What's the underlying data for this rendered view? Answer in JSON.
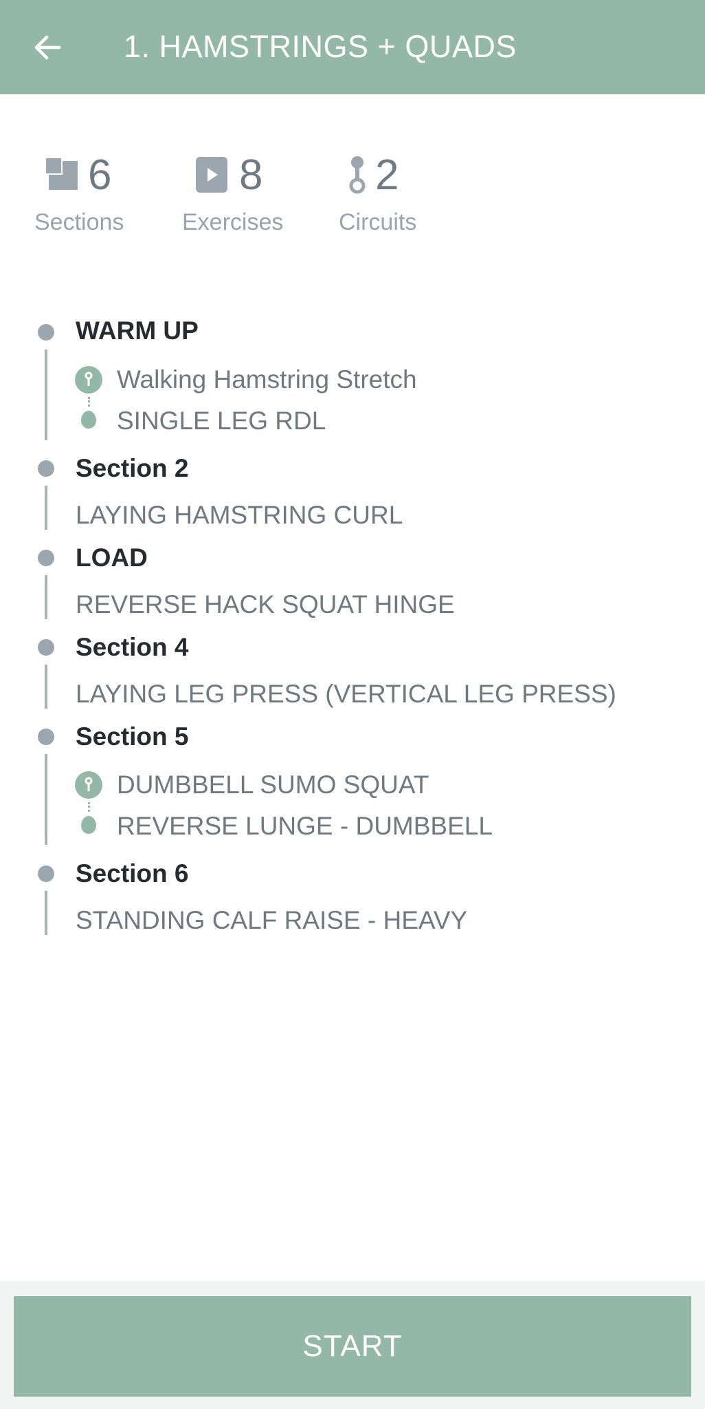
{
  "header": {
    "title": "1. HAMSTRINGS + QUADS",
    "back_icon": "arrow-left-icon"
  },
  "stats": [
    {
      "icon": "sections-icon",
      "value": "6",
      "label": "Sections"
    },
    {
      "icon": "play-icon",
      "value": "8",
      "label": "Exercises"
    },
    {
      "icon": "circuit-icon",
      "value": "2",
      "label": "Circuits"
    }
  ],
  "sections": [
    {
      "title": "WARM UP",
      "circuit": true,
      "exercises": [
        "Walking Hamstring Stretch",
        "SINGLE LEG RDL"
      ]
    },
    {
      "title": "Section 2",
      "circuit": false,
      "exercises": [
        "LAYING HAMSTRING CURL"
      ]
    },
    {
      "title": "LOAD",
      "circuit": false,
      "exercises": [
        "REVERSE HACK SQUAT HINGE"
      ]
    },
    {
      "title": "Section 4",
      "circuit": false,
      "exercises": [
        "LAYING LEG PRESS (VERTICAL LEG PRESS)"
      ]
    },
    {
      "title": "Section 5",
      "circuit": true,
      "exercises": [
        "DUMBBELL SUMO SQUAT",
        "REVERSE LUNGE - DUMBBELL"
      ]
    },
    {
      "title": "Section 6",
      "circuit": false,
      "exercises": [
        "STANDING CALF RAISE - HEAVY"
      ]
    }
  ],
  "footer": {
    "start_label": "START"
  },
  "colors": {
    "accent": "#93b8aa",
    "muted": "#9ba6ae",
    "dark_text": "#262b30",
    "body_text": "#6e7980"
  }
}
